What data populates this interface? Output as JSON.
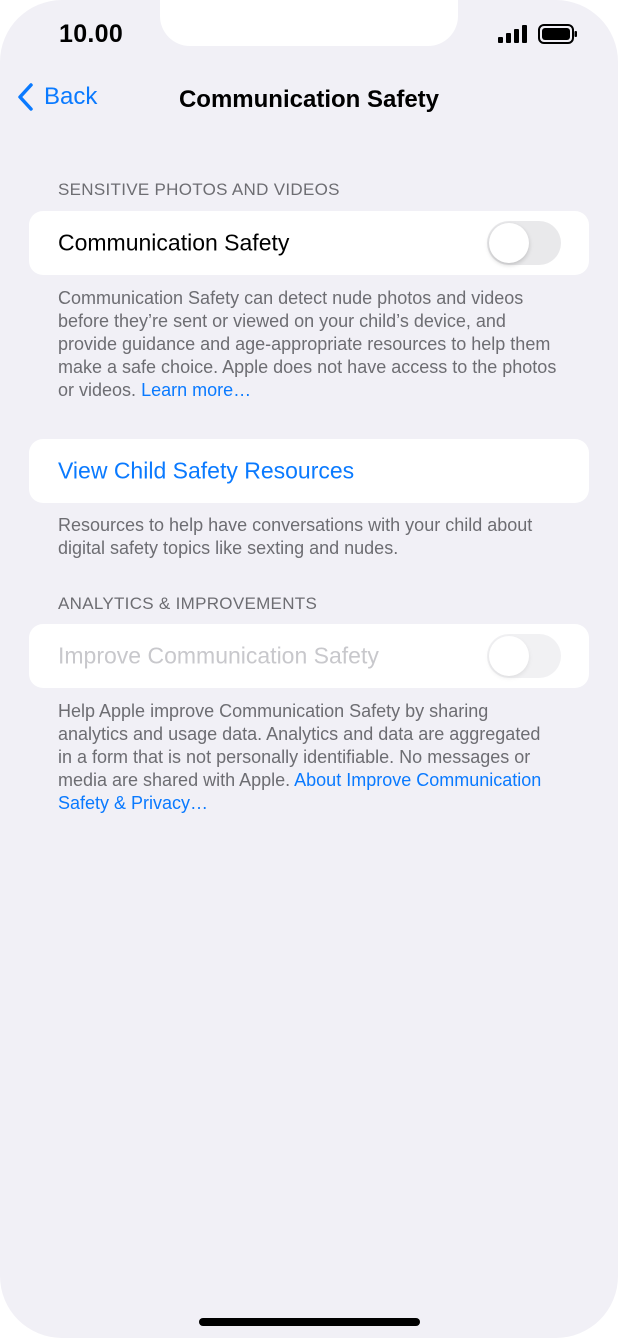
{
  "status_bar": {
    "time": "10.00",
    "signal_icon": "cellular-signal-icon",
    "battery_icon": "battery-icon"
  },
  "nav": {
    "back_label": "Back",
    "back_icon": "chevron-left-icon",
    "title": "Communication Safety"
  },
  "sensitive_section": {
    "header": "SENSITIVE PHOTOS AND VIDEOS",
    "toggle_label": "Communication Safety",
    "toggle_on": false,
    "description": "Communication Safety can detect nude photos and videos before they’re sent or viewed on your child’s device, and provide guidance and age-appropriate resources to help them make a safe choice. Apple does not have access to the photos or videos.",
    "learn_more": "Learn more…"
  },
  "resources_section": {
    "link_label": "View Child Safety Resources",
    "description": "Resources to help have conversations with your child about digital safety topics like sexting and nudes."
  },
  "analytics_section": {
    "header": "ANALYTICS & IMPROVEMENTS",
    "toggle_label": "Improve Communication Safety",
    "toggle_on": false,
    "toggle_enabled": false,
    "description": "Help Apple improve Communication Safety by sharing analytics and usage data. Analytics and data are aggregated in a form that is not personally identifiable. No messages or media are shared with Apple.",
    "about_link": "About Improve Communication Safety & Privacy…"
  },
  "colors": {
    "accent": "#0a7aff",
    "background": "#f1f0f6",
    "secondary_text": "#6d6d72",
    "disabled_text": "#c8c8cc"
  }
}
